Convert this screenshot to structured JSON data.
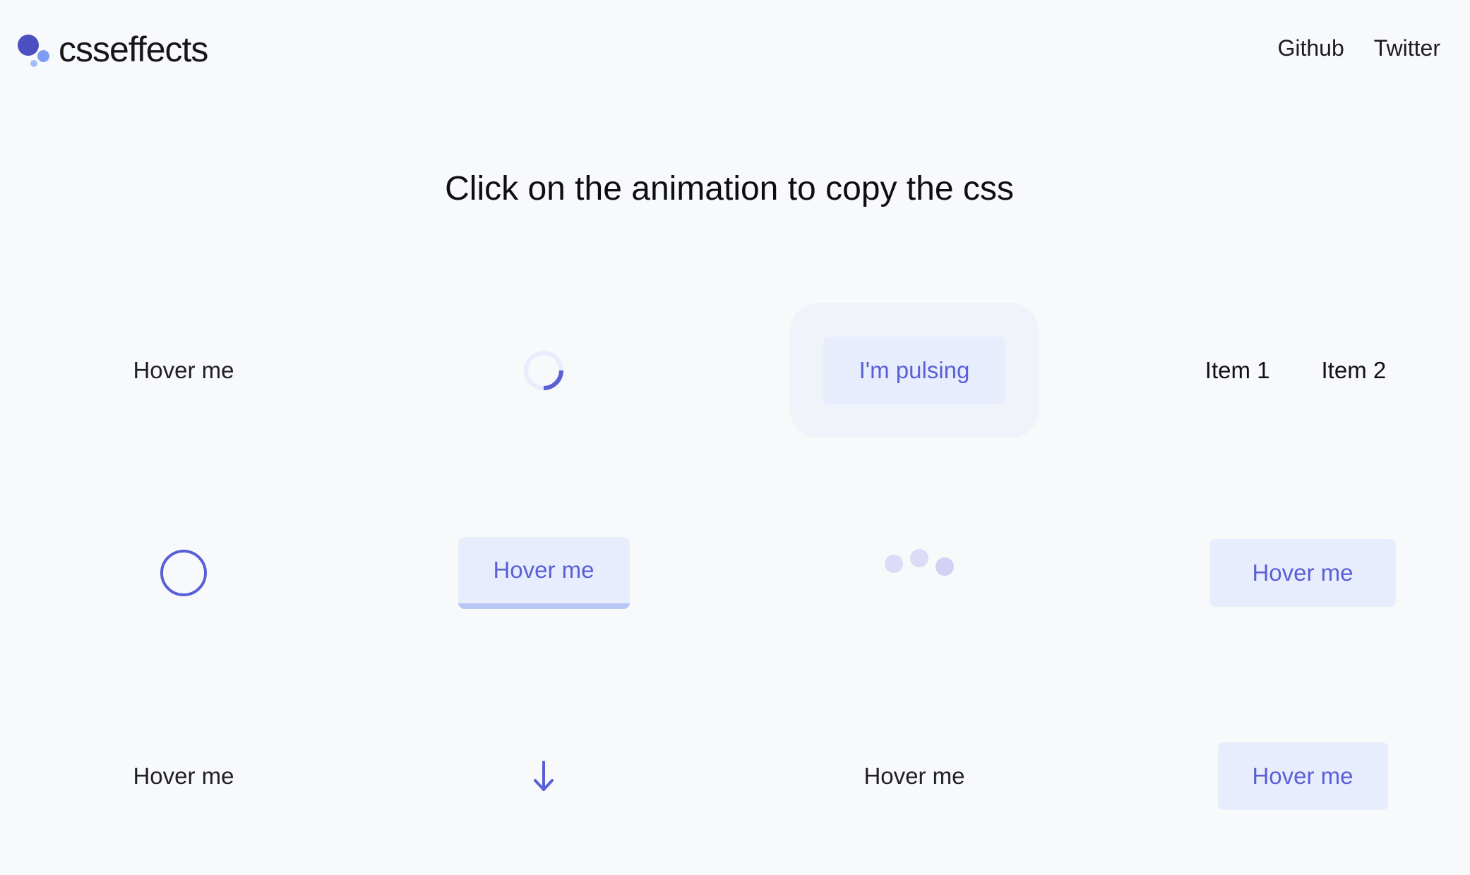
{
  "header": {
    "logo_text": "csseffects",
    "nav": [
      "Github",
      "Twitter"
    ]
  },
  "headline": "Click on the animation to copy the css",
  "effects": {
    "row1": {
      "hover_text": "Hover me",
      "pulse_label": "I'm pulsing",
      "tabs": [
        "Item 1",
        "Item 2"
      ]
    },
    "row2": {
      "border_button_label": "Hover me",
      "fill_button_label": "Hover me"
    },
    "row3": {
      "hover_text_left": "Hover me",
      "hover_text_center": "Hover me",
      "button_label": "Hover me"
    }
  },
  "icons": {
    "spinner": "loading-spinner-icon",
    "circle": "circle-icon",
    "dots": "bouncing-dots-icon",
    "arrow": "arrow-down-icon"
  },
  "colors": {
    "background": "#f8f9fb",
    "accent": "#5a5fd6",
    "button_bg": "#e8edfd",
    "logo_primary": "#4c51bf",
    "logo_secondary": "#7f9cf5"
  }
}
